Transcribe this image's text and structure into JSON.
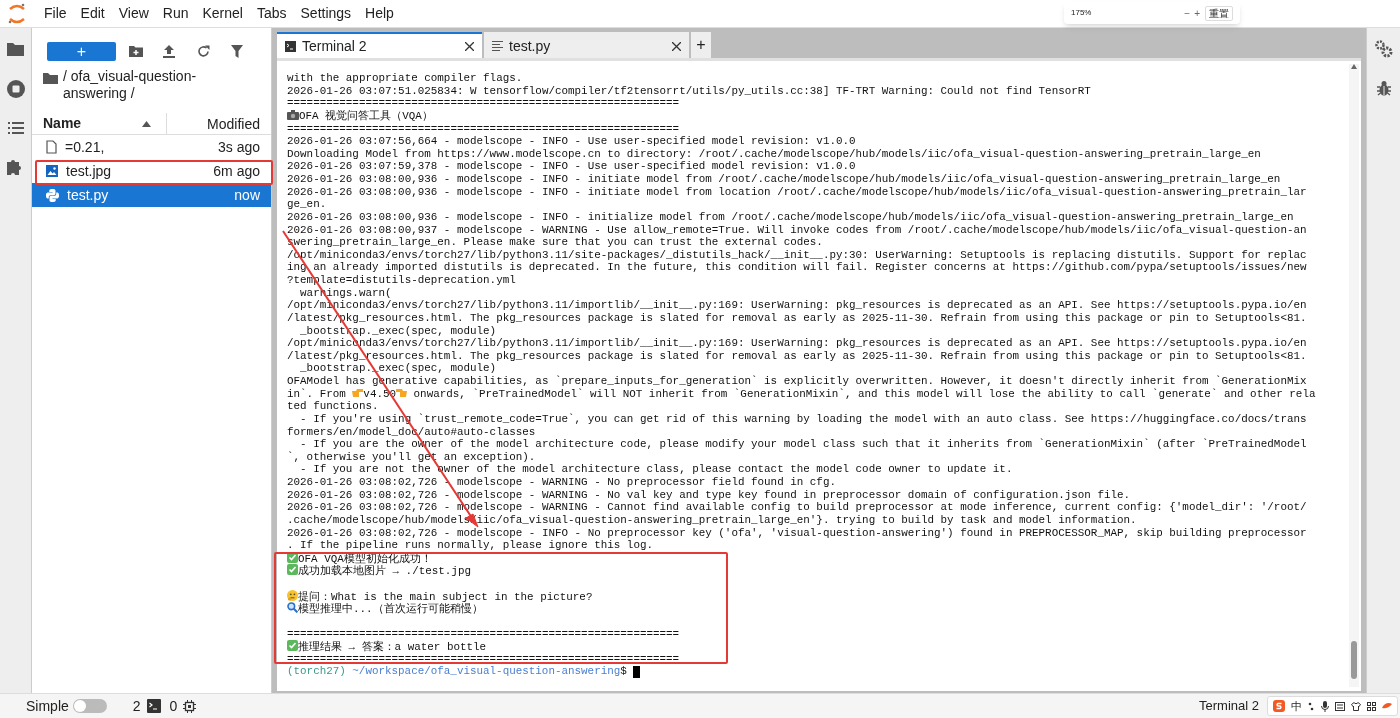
{
  "menu": [
    "File",
    "Edit",
    "View",
    "Run",
    "Kernel",
    "Tabs",
    "Settings",
    "Help"
  ],
  "zoom_popup": {
    "level": "175%",
    "minus": "−",
    "plus": "+",
    "reset": "重置"
  },
  "file_browser": {
    "new_button": "+",
    "breadcrumb": "/ ofa_visual-question-answering /",
    "columns": {
      "name": "Name",
      "modified": "Modified"
    },
    "files": [
      {
        "name": "=0.21,",
        "modified": "3s ago",
        "kind": "file",
        "selected": false
      },
      {
        "name": "test.jpg",
        "modified": "6m ago",
        "kind": "image",
        "selected": false
      },
      {
        "name": "test.py",
        "modified": "now",
        "kind": "python",
        "selected": true
      }
    ]
  },
  "tabs": [
    {
      "label": "Terminal 2",
      "kind": "terminal",
      "selected": true
    },
    {
      "label": "test.py",
      "kind": "text",
      "selected": false
    }
  ],
  "new_tab": "+",
  "terminal": {
    "lines": [
      {
        "text": "with the appropriate compiler flags."
      },
      {
        "text": "2026-01-26 03:07:51.025834: W tensorflow/compiler/tf2tensorrt/utils/py_utils.cc:38] TF-TRT Warning: Could not find TensorRT"
      },
      {
        "text": "============================================================"
      },
      {
        "kind": "camera",
        "text": "OFA 视觉问答工具（VQA）"
      },
      {
        "text": "============================================================"
      },
      {
        "text": "2026-01-26 03:07:56,664 - modelscope - INFO - Use user-specified model revision: v1.0.0"
      },
      {
        "text": "Downloading Model from https://www.modelscope.cn to directory: /root/.cache/modelscope/hub/models/iic/ofa_visual-question-answering_pretrain_large_en"
      },
      {
        "text": "2026-01-26 03:07:59,378 - modelscope - INFO - Use user-specified model revision: v1.0.0"
      },
      {
        "text": "2026-01-26 03:08:00,936 - modelscope - INFO - initiate model from /root/.cache/modelscope/hub/models/iic/ofa_visual-question-answering_pretrain_large_en"
      },
      {
        "text": "2026-01-26 03:08:00,936 - modelscope - INFO - initiate model from location /root/.cache/modelscope/hub/models/iic/ofa_visual-question-answering_pretrain_lar"
      },
      {
        "text": "ge_en."
      },
      {
        "text": "2026-01-26 03:08:00,936 - modelscope - INFO - initialize model from /root/.cache/modelscope/hub/models/iic/ofa_visual-question-answering_pretrain_large_en"
      },
      {
        "text": "2026-01-26 03:08:00,937 - modelscope - WARNING - Use allow_remote=True. Will invoke codes from /root/.cache/modelscope/hub/models/iic/ofa_visual-question-an"
      },
      {
        "text": "swering_pretrain_large_en. Please make sure that you can trust the external codes."
      },
      {
        "text": "/opt/miniconda3/envs/torch27/lib/python3.11/site-packages/_distutils_hack/__init__.py:30: UserWarning: Setuptools is replacing distutils. Support for replac"
      },
      {
        "text": "ing an already imported distutils is deprecated. In the future, this condition will fail. Register concerns at https://github.com/pypa/setuptools/issues/new"
      },
      {
        "text": "?template=distutils-deprecation.yml"
      },
      {
        "text": "  warnings.warn("
      },
      {
        "text": "/opt/miniconda3/envs/torch27/lib/python3.11/importlib/__init__.py:169: UserWarning: pkg_resources is deprecated as an API. See https://setuptools.pypa.io/en"
      },
      {
        "text": "/latest/pkg_resources.html. The pkg_resources package is slated for removal as early as 2025-11-30. Refrain from using this package or pin to Setuptools<81."
      },
      {
        "text": "  _bootstrap._exec(spec, module)"
      },
      {
        "text": "/opt/miniconda3/envs/torch27/lib/python3.11/importlib/__init__.py:169: UserWarning: pkg_resources is deprecated as an API. See https://setuptools.pypa.io/en"
      },
      {
        "text": "/latest/pkg_resources.html. The pkg_resources package is slated for removal as early as 2025-11-30. Refrain from using this package or pin to Setuptools<81."
      },
      {
        "text": "  _bootstrap._exec(spec, module)"
      },
      {
        "text": "OFAModel has generative capabilities, as `prepare_inputs_for_generation` is explicitly overwritten. However, it doesn't directly inherit from `GenerationMix"
      },
      {
        "pieces": [
          {
            "text": "in`. From "
          },
          {
            "kind": "point-right"
          },
          {
            "text": "v4.50"
          },
          {
            "kind": "point-left"
          },
          {
            "text": " onwards, `PreTrainedModel` will NOT inherit from `GenerationMixin`, and this model will lose the ability to call `generate` and other rela"
          }
        ]
      },
      {
        "text": "ted functions."
      },
      {
        "text": "  - If you're using `trust_remote_code=True`, you can get rid of this warning by loading the model with an auto class. See https://huggingface.co/docs/trans"
      },
      {
        "text": "formers/en/model_doc/auto#auto-classes"
      },
      {
        "text": "  - If you are the owner of the model architecture code, please modify your model class such that it inherits from `GenerationMixin` (after `PreTrainedModel"
      },
      {
        "text": "`, otherwise you'll get an exception)."
      },
      {
        "text": "  - If you are not the owner of the model architecture class, please contact the model code owner to update it."
      },
      {
        "text": "2026-01-26 03:08:02,726 - modelscope - WARNING - No preprocessor field found in cfg."
      },
      {
        "text": "2026-01-26 03:08:02,726 - modelscope - WARNING - No val key and type key found in preprocessor domain of configuration.json file."
      },
      {
        "text": "2026-01-26 03:08:02,726 - modelscope - WARNING - Cannot find available config to build preprocessor at mode inference, current config: {'model_dir': '/root/"
      },
      {
        "text": ".cache/modelscope/hub/models/iic/ofa_visual-question-answering_pretrain_large_en'}. trying to build by task and model information."
      },
      {
        "text": "2026-01-26 03:08:02,726 - modelscope - INFO - No preprocessor key ('ofa', 'visual-question-answering') found in PREPROCESSOR_MAP, skip building preprocessor"
      },
      {
        "text": ". If the pipeline runs normally, please ignore this log."
      },
      {
        "kind": "check",
        "text": "OFA VQA模型初始化成功！"
      },
      {
        "kind": "check",
        "text": "成功加载本地图片 → ./test.jpg"
      },
      {
        "kind": "thinking",
        "text": "提问：What is the main subject in the picture?",
        "blank_before": true
      },
      {
        "kind": "search",
        "text": "模型推理中...（首次运行可能稍慢）"
      },
      {
        "text": "============================================================",
        "blank_before": true
      },
      {
        "kind": "check",
        "text": "推理结果 → 答案：a water bottle"
      },
      {
        "text": "============================================================"
      }
    ],
    "prompt": {
      "env": "(torch27)",
      "path": "~/workspace/ofa_visual-question-answering",
      "symbol": "$"
    }
  },
  "status_bar": {
    "mode": "Simple",
    "simple_on": false,
    "terminals": "2",
    "kernels": "0",
    "current": "Terminal 2"
  },
  "tray": {
    "ime": "中"
  }
}
